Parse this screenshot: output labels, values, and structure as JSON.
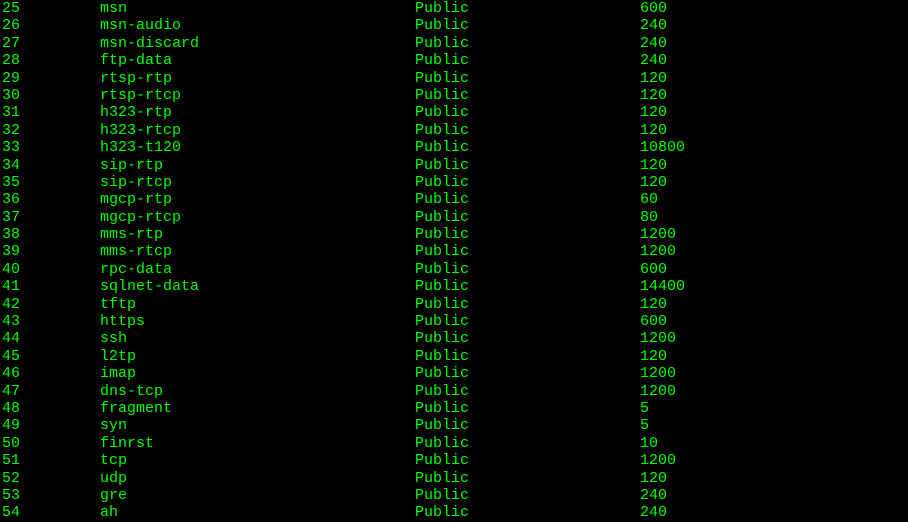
{
  "rows": [
    {
      "num": "25",
      "name": "msn",
      "scope": "Public",
      "value": "600"
    },
    {
      "num": "26",
      "name": "msn-audio",
      "scope": "Public",
      "value": "240"
    },
    {
      "num": "27",
      "name": "msn-discard",
      "scope": "Public",
      "value": "240"
    },
    {
      "num": "28",
      "name": "ftp-data",
      "scope": "Public",
      "value": "240"
    },
    {
      "num": "29",
      "name": "rtsp-rtp",
      "scope": "Public",
      "value": "120"
    },
    {
      "num": "30",
      "name": "rtsp-rtcp",
      "scope": "Public",
      "value": "120"
    },
    {
      "num": "31",
      "name": "h323-rtp",
      "scope": "Public",
      "value": "120"
    },
    {
      "num": "32",
      "name": "h323-rtcp",
      "scope": "Public",
      "value": "120"
    },
    {
      "num": "33",
      "name": "h323-t120",
      "scope": "Public",
      "value": "10800"
    },
    {
      "num": "34",
      "name": "sip-rtp",
      "scope": "Public",
      "value": "120"
    },
    {
      "num": "35",
      "name": "sip-rtcp",
      "scope": "Public",
      "value": "120"
    },
    {
      "num": "36",
      "name": "mgcp-rtp",
      "scope": "Public",
      "value": "60"
    },
    {
      "num": "37",
      "name": "mgcp-rtcp",
      "scope": "Public",
      "value": "80"
    },
    {
      "num": "38",
      "name": "mms-rtp",
      "scope": "Public",
      "value": "1200"
    },
    {
      "num": "39",
      "name": "mms-rtcp",
      "scope": "Public",
      "value": "1200"
    },
    {
      "num": "40",
      "name": "rpc-data",
      "scope": "Public",
      "value": "600"
    },
    {
      "num": "41",
      "name": "sqlnet-data",
      "scope": "Public",
      "value": "14400"
    },
    {
      "num": "42",
      "name": "tftp",
      "scope": "Public",
      "value": "120"
    },
    {
      "num": "43",
      "name": "https",
      "scope": "Public",
      "value": "600"
    },
    {
      "num": "44",
      "name": "ssh",
      "scope": "Public",
      "value": "1200"
    },
    {
      "num": "45",
      "name": "l2tp",
      "scope": "Public",
      "value": "120"
    },
    {
      "num": "46",
      "name": "imap",
      "scope": "Public",
      "value": "1200"
    },
    {
      "num": "47",
      "name": "dns-tcp",
      "scope": "Public",
      "value": "1200"
    },
    {
      "num": "48",
      "name": "fragment",
      "scope": "Public",
      "value": "5"
    },
    {
      "num": "49",
      "name": "syn",
      "scope": "Public",
      "value": "5"
    },
    {
      "num": "50",
      "name": "finrst",
      "scope": "Public",
      "value": "10"
    },
    {
      "num": "51",
      "name": "tcp",
      "scope": "Public",
      "value": "1200"
    },
    {
      "num": "52",
      "name": "udp",
      "scope": "Public",
      "value": "120"
    },
    {
      "num": "53",
      "name": "gre",
      "scope": "Public",
      "value": "240"
    },
    {
      "num": "54",
      "name": "ah",
      "scope": "Public",
      "value": "240"
    }
  ]
}
